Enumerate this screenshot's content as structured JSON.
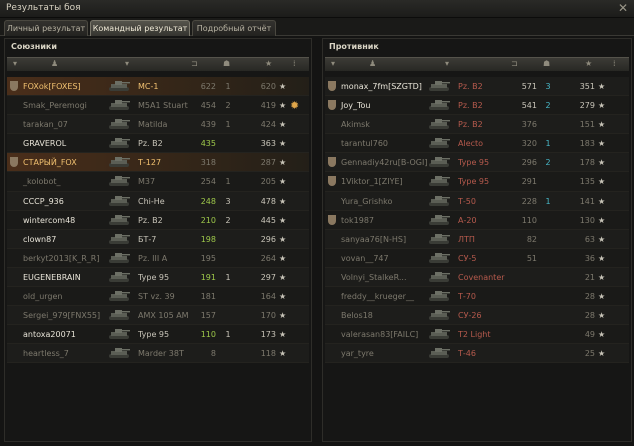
{
  "window": {
    "title": "Результаты боя",
    "close": "✕"
  },
  "tabs": [
    "Личный результат",
    "Командный результат",
    "Подробный отчёт"
  ],
  "allies": {
    "title": "Союзники",
    "rows": [
      {
        "player": "FOXok[FOXES]",
        "tank": "МС-1",
        "damage": "622",
        "kills": "1",
        "xp": "620",
        "star": "★",
        "dead": true,
        "highlight": true,
        "clan": true
      },
      {
        "player": "Smak_Peremogi",
        "tank": "M5A1 Stuart",
        "damage": "454",
        "kills": "2",
        "xp": "419",
        "star": "★",
        "dead": true,
        "medal": "✹"
      },
      {
        "player": "tarakan_07",
        "tank": "Matilda",
        "damage": "439",
        "kills": "1",
        "xp": "424",
        "star": "★",
        "dead": true
      },
      {
        "player": "GRAVEROL",
        "tank": "Pz. B2",
        "damage": "435",
        "kills": "",
        "xp": "363",
        "star": "★",
        "dead": false
      },
      {
        "player": "СТАРЫЙ_FOX",
        "tank": "Т-127",
        "damage": "318",
        "kills": "",
        "xp": "287",
        "star": "★",
        "dead": true,
        "highlight": true,
        "clan": true
      },
      {
        "player": "_kolobot_",
        "tank": "M37",
        "damage": "254",
        "kills": "1",
        "xp": "205",
        "star": "★",
        "dead": true
      },
      {
        "player": "CCCP_936",
        "tank": "Chi-He",
        "damage": "248",
        "kills": "3",
        "xp": "478",
        "star": "★",
        "dead": false
      },
      {
        "player": "wintercom48",
        "tank": "Pz. B2",
        "damage": "210",
        "kills": "2",
        "xp": "445",
        "star": "★",
        "dead": false
      },
      {
        "player": "clown87",
        "tank": "БТ-7",
        "damage": "198",
        "kills": "",
        "xp": "296",
        "star": "★",
        "dead": false
      },
      {
        "player": "berkyt2013[K_R_R]",
        "tank": "Pz. III A",
        "damage": "195",
        "kills": "",
        "xp": "264",
        "star": "★",
        "dead": true
      },
      {
        "player": "EUGENEBRAIN",
        "tank": "Type 95",
        "damage": "191",
        "kills": "1",
        "xp": "297",
        "star": "★",
        "dead": false
      },
      {
        "player": "old_urgen",
        "tank": "ST vz. 39",
        "damage": "181",
        "kills": "",
        "xp": "164",
        "star": "★",
        "dead": true
      },
      {
        "player": "Sergei_979[FNX55]",
        "tank": "AMX 105 AM",
        "damage": "157",
        "kills": "",
        "xp": "170",
        "star": "★",
        "dead": true
      },
      {
        "player": "antoxa20071",
        "tank": "Type 95",
        "damage": "110",
        "kills": "1",
        "xp": "173",
        "star": "★",
        "dead": false
      },
      {
        "player": "heartless_7",
        "tank": "Marder 38T",
        "damage": "8",
        "kills": "",
        "xp": "118",
        "star": "★",
        "dead": true
      }
    ]
  },
  "enemies": {
    "title": "Противник",
    "rows": [
      {
        "player": "monax_7fm[SZGTD]",
        "tank": "Pz. B2",
        "damage": "571",
        "kills": "3",
        "xp": "351",
        "star": "★",
        "dead": false,
        "clan": true
      },
      {
        "player": "Joy_Tou",
        "tank": "Pz. B2",
        "damage": "541",
        "kills": "2",
        "xp": "279",
        "star": "★",
        "dead": false,
        "clan": true
      },
      {
        "player": "Akimsk",
        "tank": "Pz. B2",
        "damage": "376",
        "kills": "",
        "xp": "151",
        "star": "★",
        "dead": true
      },
      {
        "player": "tarantul760",
        "tank": "Alecto",
        "damage": "320",
        "kills": "1",
        "xp": "183",
        "star": "★",
        "dead": true
      },
      {
        "player": "Gennadiy42ru[B-OGI]",
        "tank": "Type 95",
        "damage": "296",
        "kills": "2",
        "xp": "178",
        "star": "★",
        "dead": true,
        "clan": true
      },
      {
        "player": "1Viktor_1[ZIYE]",
        "tank": "Type 95",
        "damage": "291",
        "kills": "",
        "xp": "135",
        "star": "★",
        "dead": true,
        "clan": true
      },
      {
        "player": "Yura_Grishko",
        "tank": "Т-50",
        "damage": "228",
        "kills": "1",
        "xp": "141",
        "star": "★",
        "dead": true
      },
      {
        "player": "tok1987",
        "tank": "А-20",
        "damage": "110",
        "kills": "",
        "xp": "130",
        "star": "★",
        "dead": true,
        "clan": true
      },
      {
        "player": "sanyaa76[N-HS]",
        "tank": "ЛТП",
        "damage": "82",
        "kills": "",
        "xp": "63",
        "star": "★",
        "dead": true
      },
      {
        "player": "vovan__747",
        "tank": "СУ-5",
        "damage": "51",
        "kills": "",
        "xp": "36",
        "star": "★",
        "dead": true
      },
      {
        "player": "Volnyi_StalkeR...",
        "tank": "Covenanter",
        "damage": "",
        "kills": "",
        "xp": "21",
        "star": "★",
        "dead": true
      },
      {
        "player": "freddy__krueger__",
        "tank": "Т-70",
        "damage": "",
        "kills": "",
        "xp": "28",
        "star": "★",
        "dead": true
      },
      {
        "player": "Belos18",
        "tank": "СУ-26",
        "damage": "",
        "kills": "",
        "xp": "28",
        "star": "★",
        "dead": true
      },
      {
        "player": "valerasan83[FAILC]",
        "tank": "T2 Light",
        "damage": "",
        "kills": "",
        "xp": "49",
        "star": "★",
        "dead": true
      },
      {
        "player": "yar_tyre",
        "tank": "Т-46",
        "damage": "",
        "kills": "",
        "xp": "25",
        "star": "★",
        "dead": true
      }
    ]
  },
  "header_icons": [
    "▾",
    "♟",
    "▾",
    "⊐",
    "☗",
    "★",
    "⁞"
  ],
  "colors": {
    "highlight": "#f0c070",
    "enemy_tank": "#b65a4d",
    "ally_damage": "#9ec84a",
    "enemy_kills": "#47b6c6"
  }
}
